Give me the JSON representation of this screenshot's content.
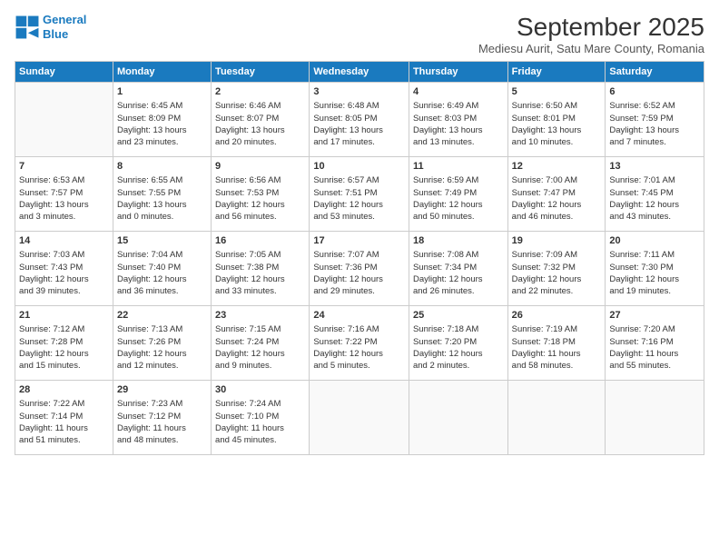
{
  "logo": {
    "line1": "General",
    "line2": "Blue"
  },
  "title": "September 2025",
  "subtitle": "Mediesu Aurit, Satu Mare County, Romania",
  "days_of_week": [
    "Sunday",
    "Monday",
    "Tuesday",
    "Wednesday",
    "Thursday",
    "Friday",
    "Saturday"
  ],
  "weeks": [
    [
      {
        "day": "",
        "info": ""
      },
      {
        "day": "1",
        "info": "Sunrise: 6:45 AM\nSunset: 8:09 PM\nDaylight: 13 hours\nand 23 minutes."
      },
      {
        "day": "2",
        "info": "Sunrise: 6:46 AM\nSunset: 8:07 PM\nDaylight: 13 hours\nand 20 minutes."
      },
      {
        "day": "3",
        "info": "Sunrise: 6:48 AM\nSunset: 8:05 PM\nDaylight: 13 hours\nand 17 minutes."
      },
      {
        "day": "4",
        "info": "Sunrise: 6:49 AM\nSunset: 8:03 PM\nDaylight: 13 hours\nand 13 minutes."
      },
      {
        "day": "5",
        "info": "Sunrise: 6:50 AM\nSunset: 8:01 PM\nDaylight: 13 hours\nand 10 minutes."
      },
      {
        "day": "6",
        "info": "Sunrise: 6:52 AM\nSunset: 7:59 PM\nDaylight: 13 hours\nand 7 minutes."
      }
    ],
    [
      {
        "day": "7",
        "info": "Sunrise: 6:53 AM\nSunset: 7:57 PM\nDaylight: 13 hours\nand 3 minutes."
      },
      {
        "day": "8",
        "info": "Sunrise: 6:55 AM\nSunset: 7:55 PM\nDaylight: 13 hours\nand 0 minutes."
      },
      {
        "day": "9",
        "info": "Sunrise: 6:56 AM\nSunset: 7:53 PM\nDaylight: 12 hours\nand 56 minutes."
      },
      {
        "day": "10",
        "info": "Sunrise: 6:57 AM\nSunset: 7:51 PM\nDaylight: 12 hours\nand 53 minutes."
      },
      {
        "day": "11",
        "info": "Sunrise: 6:59 AM\nSunset: 7:49 PM\nDaylight: 12 hours\nand 50 minutes."
      },
      {
        "day": "12",
        "info": "Sunrise: 7:00 AM\nSunset: 7:47 PM\nDaylight: 12 hours\nand 46 minutes."
      },
      {
        "day": "13",
        "info": "Sunrise: 7:01 AM\nSunset: 7:45 PM\nDaylight: 12 hours\nand 43 minutes."
      }
    ],
    [
      {
        "day": "14",
        "info": "Sunrise: 7:03 AM\nSunset: 7:43 PM\nDaylight: 12 hours\nand 39 minutes."
      },
      {
        "day": "15",
        "info": "Sunrise: 7:04 AM\nSunset: 7:40 PM\nDaylight: 12 hours\nand 36 minutes."
      },
      {
        "day": "16",
        "info": "Sunrise: 7:05 AM\nSunset: 7:38 PM\nDaylight: 12 hours\nand 33 minutes."
      },
      {
        "day": "17",
        "info": "Sunrise: 7:07 AM\nSunset: 7:36 PM\nDaylight: 12 hours\nand 29 minutes."
      },
      {
        "day": "18",
        "info": "Sunrise: 7:08 AM\nSunset: 7:34 PM\nDaylight: 12 hours\nand 26 minutes."
      },
      {
        "day": "19",
        "info": "Sunrise: 7:09 AM\nSunset: 7:32 PM\nDaylight: 12 hours\nand 22 minutes."
      },
      {
        "day": "20",
        "info": "Sunrise: 7:11 AM\nSunset: 7:30 PM\nDaylight: 12 hours\nand 19 minutes."
      }
    ],
    [
      {
        "day": "21",
        "info": "Sunrise: 7:12 AM\nSunset: 7:28 PM\nDaylight: 12 hours\nand 15 minutes."
      },
      {
        "day": "22",
        "info": "Sunrise: 7:13 AM\nSunset: 7:26 PM\nDaylight: 12 hours\nand 12 minutes."
      },
      {
        "day": "23",
        "info": "Sunrise: 7:15 AM\nSunset: 7:24 PM\nDaylight: 12 hours\nand 9 minutes."
      },
      {
        "day": "24",
        "info": "Sunrise: 7:16 AM\nSunset: 7:22 PM\nDaylight: 12 hours\nand 5 minutes."
      },
      {
        "day": "25",
        "info": "Sunrise: 7:18 AM\nSunset: 7:20 PM\nDaylight: 12 hours\nand 2 minutes."
      },
      {
        "day": "26",
        "info": "Sunrise: 7:19 AM\nSunset: 7:18 PM\nDaylight: 11 hours\nand 58 minutes."
      },
      {
        "day": "27",
        "info": "Sunrise: 7:20 AM\nSunset: 7:16 PM\nDaylight: 11 hours\nand 55 minutes."
      }
    ],
    [
      {
        "day": "28",
        "info": "Sunrise: 7:22 AM\nSunset: 7:14 PM\nDaylight: 11 hours\nand 51 minutes."
      },
      {
        "day": "29",
        "info": "Sunrise: 7:23 AM\nSunset: 7:12 PM\nDaylight: 11 hours\nand 48 minutes."
      },
      {
        "day": "30",
        "info": "Sunrise: 7:24 AM\nSunset: 7:10 PM\nDaylight: 11 hours\nand 45 minutes."
      },
      {
        "day": "",
        "info": ""
      },
      {
        "day": "",
        "info": ""
      },
      {
        "day": "",
        "info": ""
      },
      {
        "day": "",
        "info": ""
      }
    ]
  ]
}
